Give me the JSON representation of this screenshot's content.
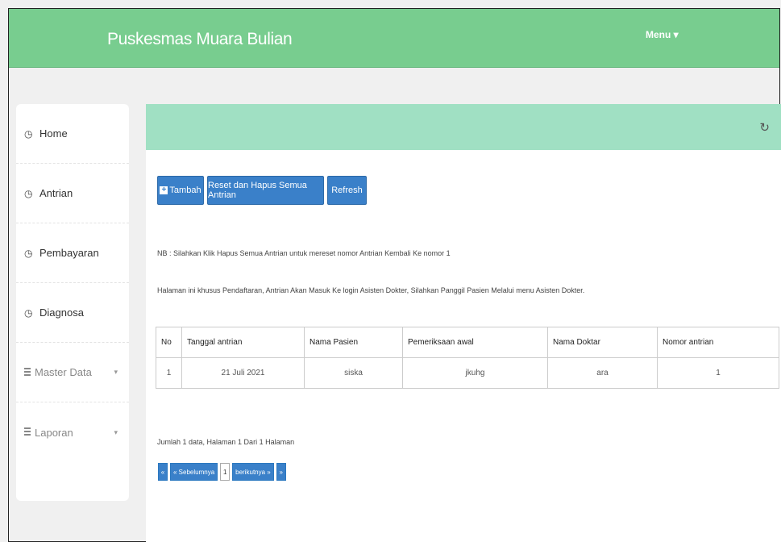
{
  "app": {
    "brand": "Puskesmas Muara Bulian",
    "menu_label": "Menu ▾"
  },
  "sidebar": {
    "items": [
      {
        "label": "Home",
        "icon": "clock-icon"
      },
      {
        "label": "Antrian",
        "icon": "clock-icon"
      },
      {
        "label": "Pembayaran",
        "icon": "clock-icon"
      },
      {
        "label": "Diagnosa",
        "icon": "clock-icon"
      },
      {
        "label": "Master Data",
        "icon": "list-icon",
        "caret": "▾"
      },
      {
        "label": "Laporan",
        "icon": "list-icon",
        "caret": "▾"
      }
    ]
  },
  "toolbar": {
    "add_label": "Tambah",
    "reset_label": "Reset dan Hapus Semua Antrian",
    "refresh_label": "Refresh"
  },
  "notes": {
    "nb": "NB : Silahkan Klik Hapus Semua Antrian untuk mereset nomor Antrian Kembali Ke nomor 1",
    "info": "Halaman ini khusus Pendaftaran, Antrian Akan Masuk Ke login Asisten Dokter, Silahkan Panggil Pasien Melalui menu Asisten Dokter."
  },
  "table": {
    "headers": [
      "No",
      "Tanggal antrian",
      "Nama Pasien",
      "Pemeriksaan awal",
      "Nama Doktar",
      "Nomor antrian"
    ],
    "rows": [
      [
        "1",
        "21 Juli 2021",
        "siska",
        "jkuhg",
        "ara",
        "1"
      ]
    ]
  },
  "summary": "Jumlah 1 data, Halaman 1 Dari 1 Halaman",
  "pagination": {
    "first": "«",
    "prev": "« Sebelumnya",
    "current": "1",
    "next": "berikutnya »",
    "last": "»"
  },
  "colors": {
    "navbar": "#78cd8f",
    "panel_header": "#a0e0c3",
    "button": "#3a80c9"
  }
}
